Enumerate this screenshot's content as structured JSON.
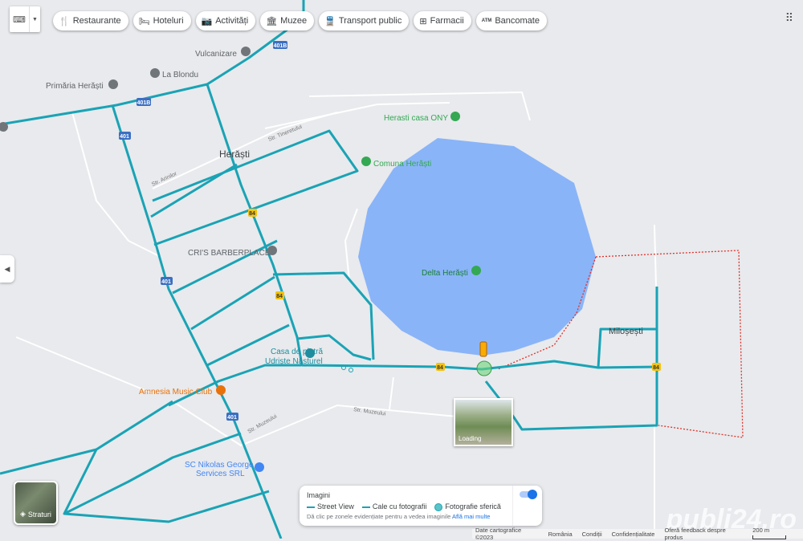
{
  "toolbar": {
    "keyboard_icon": "keyboard-icon",
    "chips": [
      {
        "label": "Restaurante",
        "icon": "🍴"
      },
      {
        "label": "Hoteluri",
        "icon": "🛏"
      },
      {
        "label": "Activități",
        "icon": "📷"
      },
      {
        "label": "Muzee",
        "icon": "🏛"
      },
      {
        "label": "Transport public",
        "icon": "🚆"
      },
      {
        "label": "Farmacii",
        "icon": "⊞"
      },
      {
        "label": "Bancomate",
        "icon": "ATM"
      }
    ],
    "apps_icon": "⋮⋮⋮"
  },
  "map": {
    "places": {
      "vulcanizare": "Vulcanizare",
      "la_blondu": "La Blondu",
      "primaria": "Primăria Herăști",
      "casa_ony": "Herasti casa ONY",
      "herasti": "Herăști",
      "comuna": "Comuna Herăști",
      "barber": "CRI'S BARBERPLACE",
      "delta": "Delta Herăști",
      "milosesti": "Miloșești",
      "casa_piatra_1": "Casa de piatră",
      "casa_piatra_2": "Udriște Năsturel",
      "amnesia": "Amnesia Music Club",
      "nikolas_1": "SC Nikolas George",
      "nikolas_2": "Services SRL"
    },
    "streets": {
      "tineretului": "Str. Tineretului",
      "arinilor": "Str. Arinilor",
      "muzeului": "Str. Muzeului"
    },
    "road_shields": {
      "r401b": "401B",
      "r401": "401",
      "r84": "84"
    },
    "colors": {
      "water": "#8ab4f8",
      "street_view": "#1aa3b5",
      "boundary": "#e0312a",
      "land": "#e8eaed"
    }
  },
  "street_view_thumb": {
    "status": "Loading"
  },
  "layers_button": {
    "label": "Straturi"
  },
  "legend": {
    "title": "Imagini",
    "street_view": "Street View",
    "cale": "Cale cu fotografii",
    "sferica": "Fotografie sferică",
    "hint": "Dă clic pe zonele evidențiate pentru a vedea imaginile",
    "link": "Află mai multe",
    "toggle_on": true
  },
  "footer": {
    "data": "Date cartografice ©2023",
    "country": "România",
    "terms": "Condiții",
    "privacy": "Confidențialitate",
    "feedback": "Oferă feedback despre produs",
    "scale": "200 m"
  },
  "watermark": "publi24.ro"
}
